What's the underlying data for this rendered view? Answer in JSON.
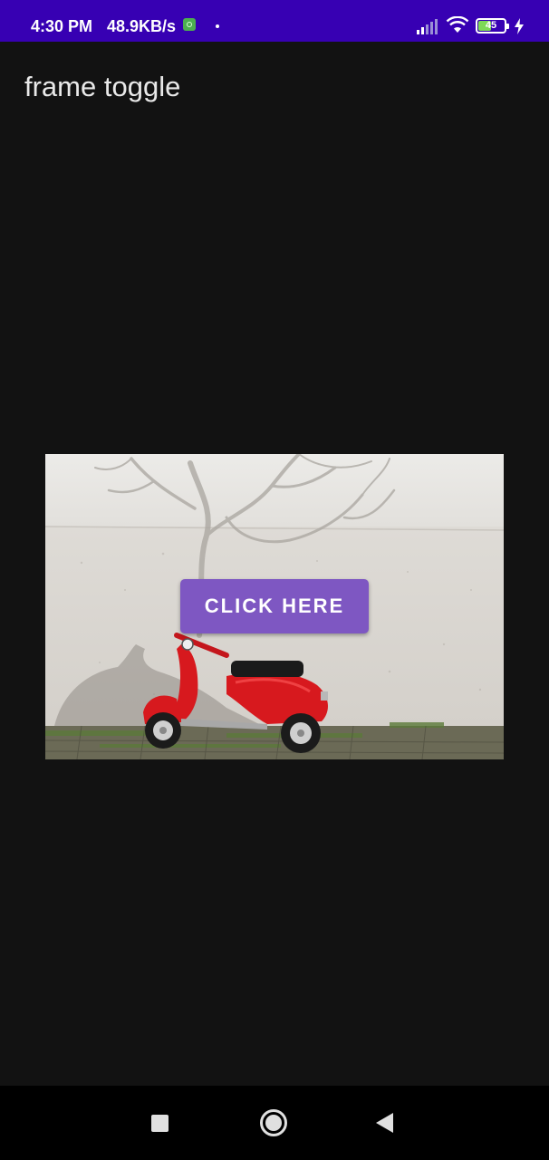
{
  "status_bar": {
    "time": "4:30 PM",
    "network_speed": "48.9KB/s",
    "battery_level": "45",
    "icons": [
      "app-notification-icon",
      "dot-icon",
      "signal-icon",
      "wifi-icon",
      "battery-icon",
      "charging-icon"
    ]
  },
  "app": {
    "title": "frame toggle"
  },
  "frame": {
    "image_description": "red-scooter-photo",
    "button_label": "CLICK HERE",
    "button_color": "#7e57c2"
  },
  "nav_bar": {
    "icons": [
      "recents-icon",
      "home-icon",
      "back-icon"
    ]
  },
  "colors": {
    "status_bar": "#3700b3",
    "background": "#121212",
    "accent": "#7e57c2"
  }
}
